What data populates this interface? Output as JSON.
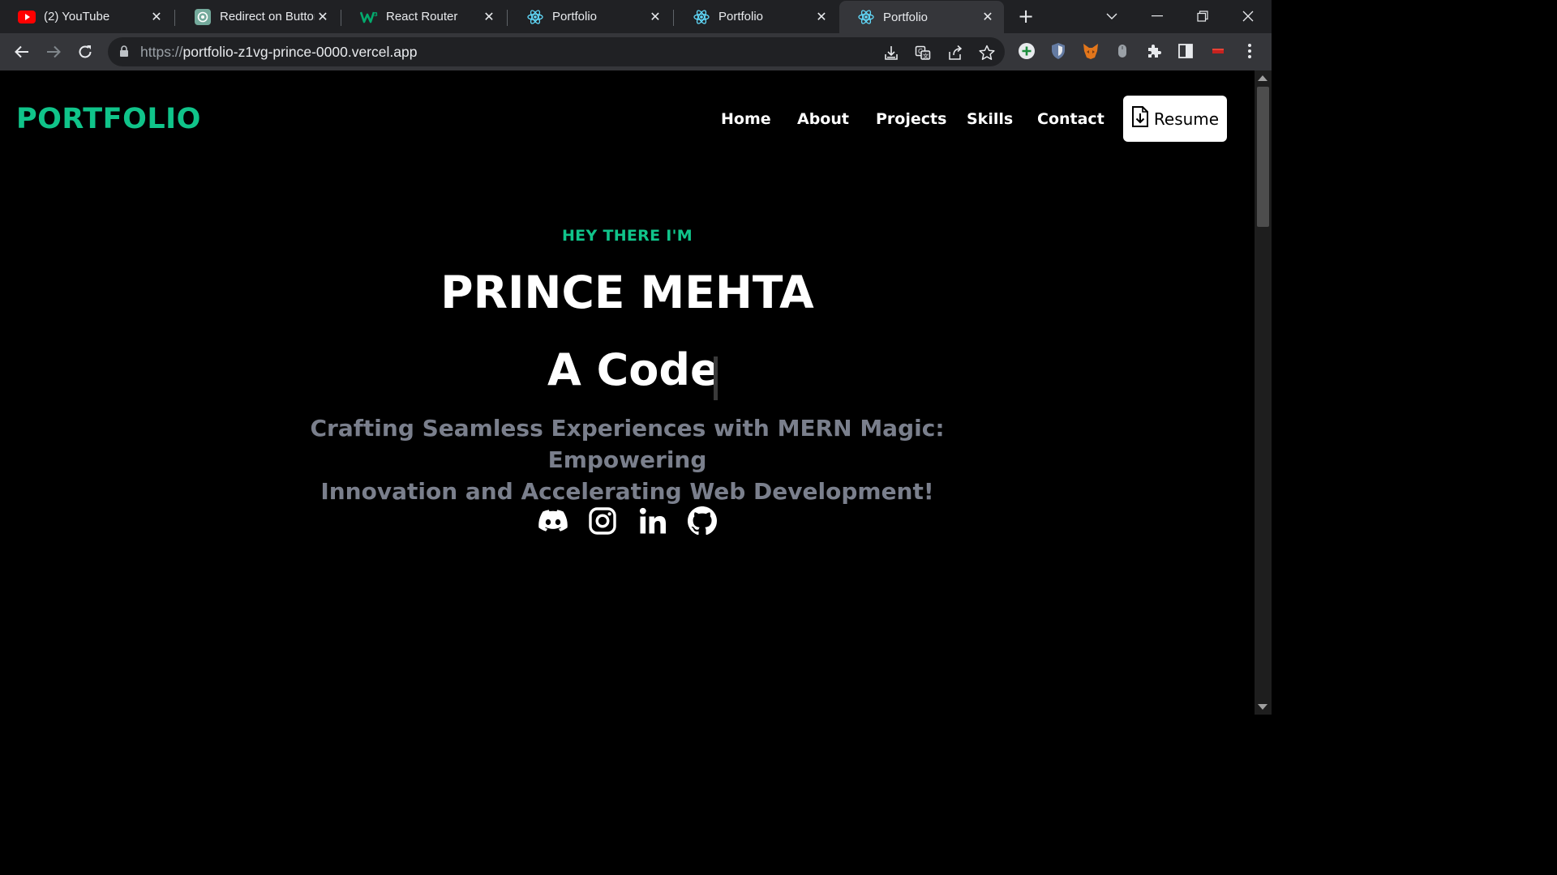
{
  "browser": {
    "tabs": [
      {
        "title": "(2) YouTube",
        "icon": "youtube-icon",
        "active": false
      },
      {
        "title": "Redirect on Button",
        "icon": "openai-icon",
        "active": false
      },
      {
        "title": "React Router",
        "icon": "w3-icon",
        "active": false
      },
      {
        "title": "Portfolio",
        "icon": "react-icon",
        "active": false
      },
      {
        "title": "Portfolio",
        "icon": "react-icon",
        "active": false
      },
      {
        "title": "Portfolio",
        "icon": "react-icon",
        "active": true
      }
    ],
    "url_scheme": "https://",
    "url_host": "portfolio-z1vg-prince-0000.vercel.app"
  },
  "site": {
    "logo": "PORTFOLIO",
    "nav": [
      "Home",
      "About",
      "Projects",
      "Skills",
      "Contact"
    ],
    "resume_label": "Resume"
  },
  "hero": {
    "eyebrow": "HEY THERE I'M",
    "name": "PRINCE MEHTA",
    "typed_text": "A Code",
    "tagline_line1": "Crafting Seamless Experiences with MERN Magic: Empowering",
    "tagline_line2": "Innovation and Accelerating Web Development!"
  },
  "social": [
    "discord-icon",
    "instagram-icon",
    "linkedin-icon",
    "github-icon"
  ],
  "colors": {
    "accent": "#10c48a",
    "tagline": "#7a7f8c",
    "page_bg": "#000000",
    "chrome_dark": "#202124",
    "chrome_toolbar": "#35363a"
  }
}
